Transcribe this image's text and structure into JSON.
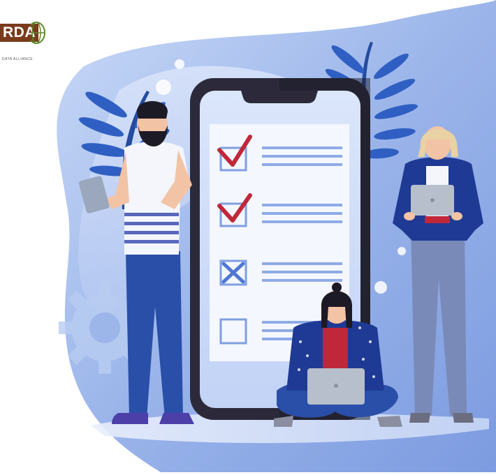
{
  "logo": {
    "name": "RDA",
    "tagline": "DATA ALLIANCE"
  },
  "illustration": {
    "phone_screen": {
      "checklist": [
        {
          "state": "checked",
          "icon": "checkmark-icon"
        },
        {
          "state": "checked",
          "icon": "checkmark-icon"
        },
        {
          "state": "crossed",
          "icon": "x-box-icon"
        },
        {
          "state": "empty",
          "icon": "empty-box-icon"
        }
      ]
    },
    "people": [
      "bearded man with tablet",
      "woman sitting with laptop",
      "blonde woman with laptop"
    ]
  },
  "colors": {
    "background_blob": "#9bb5ea",
    "phone_frame": "#2c2a3a",
    "phone_screen": "#eaf1fd",
    "check_red": "#c0283a",
    "box_blue": "#7f9fe0",
    "leaf_blue": "#2f5fc2",
    "gear": "#b9cdf2"
  }
}
